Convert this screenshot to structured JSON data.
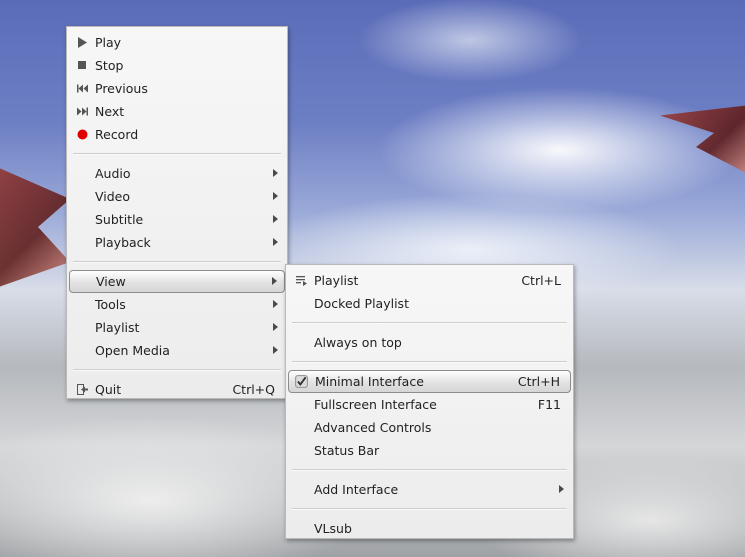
{
  "main_menu": {
    "group1": [
      {
        "label": "Play",
        "icon": "play-icon"
      },
      {
        "label": "Stop",
        "icon": "stop-icon"
      },
      {
        "label": "Previous",
        "icon": "previous-icon"
      },
      {
        "label": "Next",
        "icon": "next-icon"
      },
      {
        "label": "Record",
        "icon": "record-icon"
      }
    ],
    "group2": [
      {
        "label": "Audio"
      },
      {
        "label": "Video"
      },
      {
        "label": "Subtitle"
      },
      {
        "label": "Playback"
      }
    ],
    "group3": [
      {
        "label": "View",
        "highlighted": true
      },
      {
        "label": "Tools"
      },
      {
        "label": "Playlist"
      },
      {
        "label": "Open Media"
      }
    ],
    "quit": {
      "label": "Quit",
      "shortcut": "Ctrl+Q",
      "icon": "quit-icon"
    }
  },
  "view_submenu": {
    "playlist": {
      "label": "Playlist",
      "shortcut": "Ctrl+L",
      "icon": "playlist-icon"
    },
    "docked_playlist": {
      "label": "Docked Playlist"
    },
    "always_on_top": {
      "label": "Always on top"
    },
    "minimal_interface": {
      "label": "Minimal Interface",
      "shortcut": "Ctrl+H",
      "checked": true,
      "icon": "checkmark-icon"
    },
    "fullscreen_interface": {
      "label": "Fullscreen Interface",
      "shortcut": "F11"
    },
    "advanced_controls": {
      "label": "Advanced Controls"
    },
    "status_bar": {
      "label": "Status Bar"
    },
    "add_interface": {
      "label": "Add Interface"
    },
    "vlsub": {
      "label": "VLsub"
    }
  },
  "colors": {
    "record_red": "#e00000",
    "menu_bg": "#f2f2f2",
    "text": "#222222"
  }
}
